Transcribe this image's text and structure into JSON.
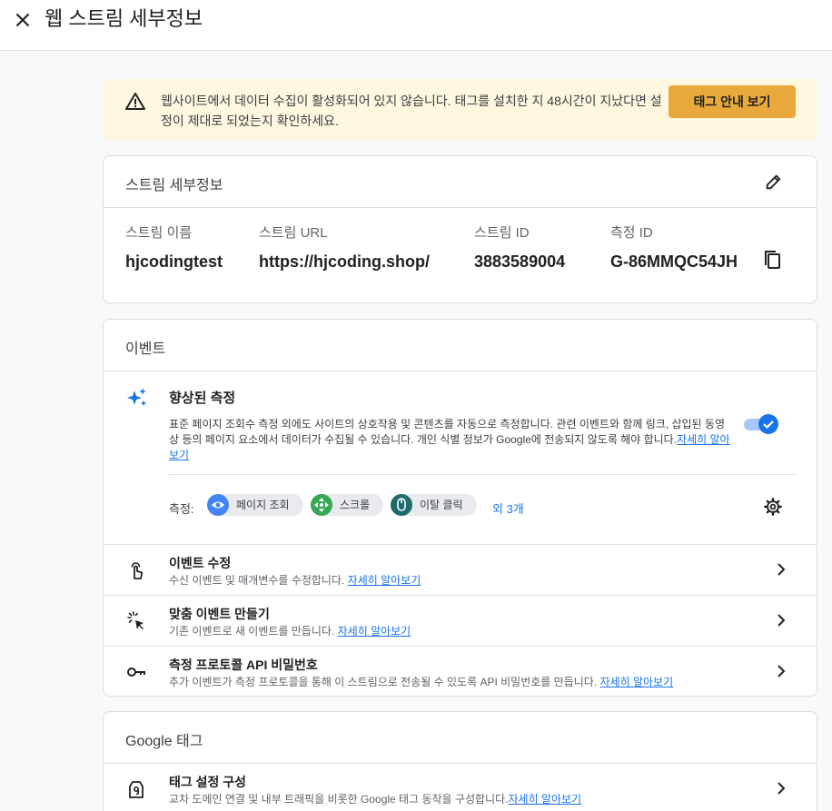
{
  "header": {
    "title": "웹 스트림 세부정보",
    "close_icon": "close-icon"
  },
  "banner": {
    "message": "웹사이트에서 데이터 수집이 활성화되어 있지 않습니다. 태그를 설치한 지 48시간이 지났다면 설정이 제대로 되었는지 확인하세요.",
    "button_label": "태그 안내 보기",
    "icon": "warning-icon",
    "background_color": "#fef7e0",
    "button_color": "#e8a93a"
  },
  "stream": {
    "title": "스트림 세부정보",
    "fields": [
      {
        "label": "스트림 이름",
        "value": "hjcodingtest"
      },
      {
        "label": "스트림 URL",
        "value": "https://hjcoding.shop/"
      },
      {
        "label": "스트림 ID",
        "value": "3883589004"
      },
      {
        "label": "측정 ID",
        "value": "G-86MMQC54JH"
      }
    ]
  },
  "events": {
    "title": "이벤트",
    "enhanced": {
      "heading": "향상된 측정",
      "description": "표준 페이지 조회수 측정 외에도 사이트의 상호작용 및 콘텐츠를 자동으로 측정합니다. 관련 이벤트와 함께 링크, 삽입된 동영상 등의 페이지 요소에서 데이터가 수집될 수 있습니다. 개인 식별 정보가 Google에 전송되지 않도록 해야 합니다.",
      "link": "자세히 알아보기",
      "toggle_on": true,
      "measure_label": "측정:",
      "chips": [
        {
          "label": "페이지 조회",
          "icon": "eye-icon",
          "color": "#4285f4"
        },
        {
          "label": "스크롤",
          "icon": "scroll-icon",
          "color": "#34a853"
        },
        {
          "label": "이탈 클릭",
          "icon": "mouse-icon",
          "color": "#1e6b6b"
        }
      ],
      "more_label": "외 3개"
    },
    "rows": [
      {
        "title": "이벤트 수정",
        "desc": "수신 이벤트 및 매개변수를 수정합니다. ",
        "link": "자세히 알아보기",
        "icon": "touch-icon"
      },
      {
        "title": "맞춤 이벤트 만들기",
        "desc": "기존 이벤트로 새 이벤트를 만듭니다. ",
        "link": "자세히 알아보기",
        "icon": "click-sparkle-icon"
      },
      {
        "title": "측정 프로토콜 API 비밀번호",
        "desc": "추가 이벤트가 측정 프로토콜을 통해 이 스트림으로 전송될 수 있도록 API 비밀번호를 만듭니다. ",
        "link": "자세히 알아보기",
        "icon": "key-icon"
      }
    ]
  },
  "gtag": {
    "title": "Google 태그",
    "rows": [
      {
        "title": "태그 설정 구성",
        "desc": "교차 도메인 연결 및 내부 트래픽을 비롯한 Google 태그 동작을 구성합니다.",
        "link": "자세히 알아보기",
        "icon": "tag-icon"
      }
    ]
  },
  "colors": {
    "accent": "#1a73e8",
    "text": "#202124",
    "border": "#dadce0"
  }
}
